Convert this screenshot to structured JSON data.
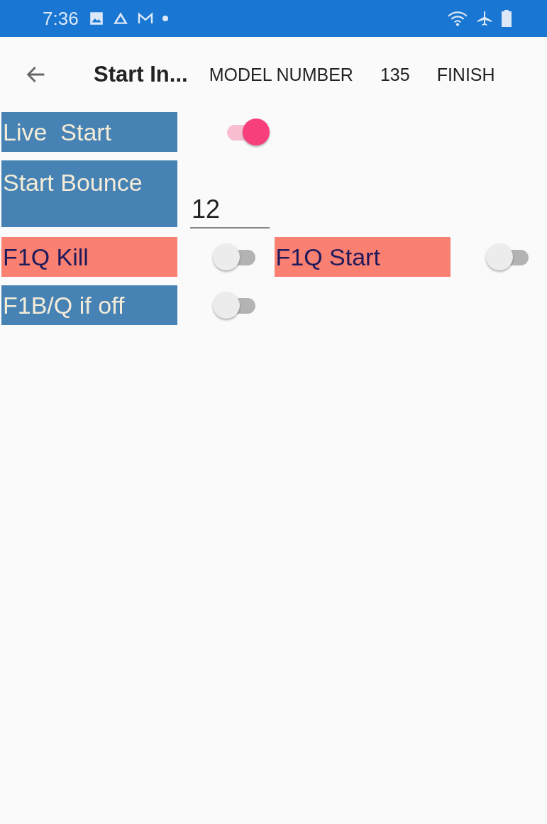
{
  "status_bar": {
    "time": "7:36"
  },
  "toolbar": {
    "title": "Start In...",
    "actions": [
      "MODEL NUMBER",
      "135",
      "FINISH"
    ]
  },
  "rows": [
    {
      "items": [
        {
          "label": "Live  Start",
          "color": "#4682b4",
          "control": {
            "kind": "switch",
            "on": true
          }
        }
      ]
    },
    {
      "items": [
        {
          "label": "Start Bounce",
          "color": "#4682b4",
          "control": {
            "kind": "entry",
            "value": "12"
          }
        }
      ]
    },
    {
      "items": [
        {
          "label": "F1Q Kill",
          "color": "#fa8072",
          "control": {
            "kind": "switch",
            "on": false
          }
        },
        {
          "label": "F1Q Start",
          "color": "#fa8072",
          "control": {
            "kind": "switch",
            "on": false
          }
        }
      ]
    },
    {
      "items": [
        {
          "label": "F1B/Q if off",
          "color": "#4682b4",
          "control": {
            "kind": "switch",
            "on": false
          }
        }
      ]
    }
  ]
}
